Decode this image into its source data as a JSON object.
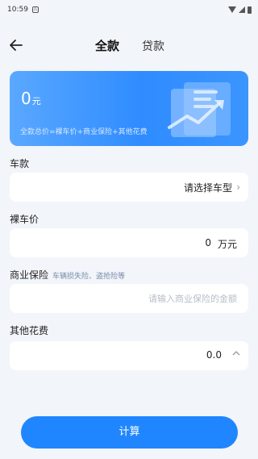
{
  "status_bar": {
    "time": "10:59",
    "notif": "⚠"
  },
  "header": {
    "back_icon": "arrow-left-icon",
    "tab_full": "全款",
    "tab_loan": "贷款"
  },
  "summary": {
    "amount": "0",
    "unit": "元",
    "formula": "全款总价=裸车价+商业保险+其他花费"
  },
  "car_model": {
    "label": "车款",
    "placeholder": "请选择车型"
  },
  "bare_price": {
    "label": "裸车价",
    "value": "0",
    "unit": "万元"
  },
  "insurance": {
    "label": "商业保险",
    "hint": "车辆损失险、盗抢险等",
    "placeholder": "请输入商业保险的金额"
  },
  "other_costs": {
    "label": "其他花费",
    "value": "0.0"
  },
  "actions": {
    "calculate": "计算"
  },
  "colors": {
    "accent": "#1f86ff",
    "background": "#f2f5fa"
  }
}
